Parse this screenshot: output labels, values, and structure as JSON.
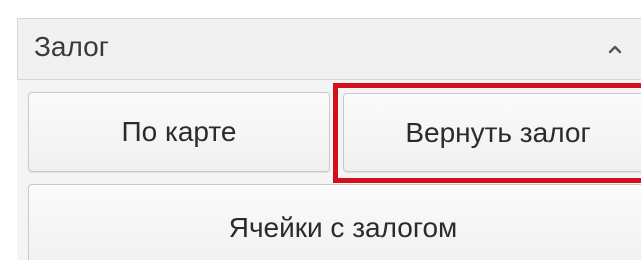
{
  "panel": {
    "title": "Залог"
  },
  "icons": {
    "collapse": "chevron-up-icon"
  },
  "buttons": {
    "by_card": "По карте",
    "return_deposit": "Вернуть залог",
    "cells_with_deposit": "Ячейки с залогом"
  },
  "colors": {
    "highlight": "#d0111b"
  }
}
